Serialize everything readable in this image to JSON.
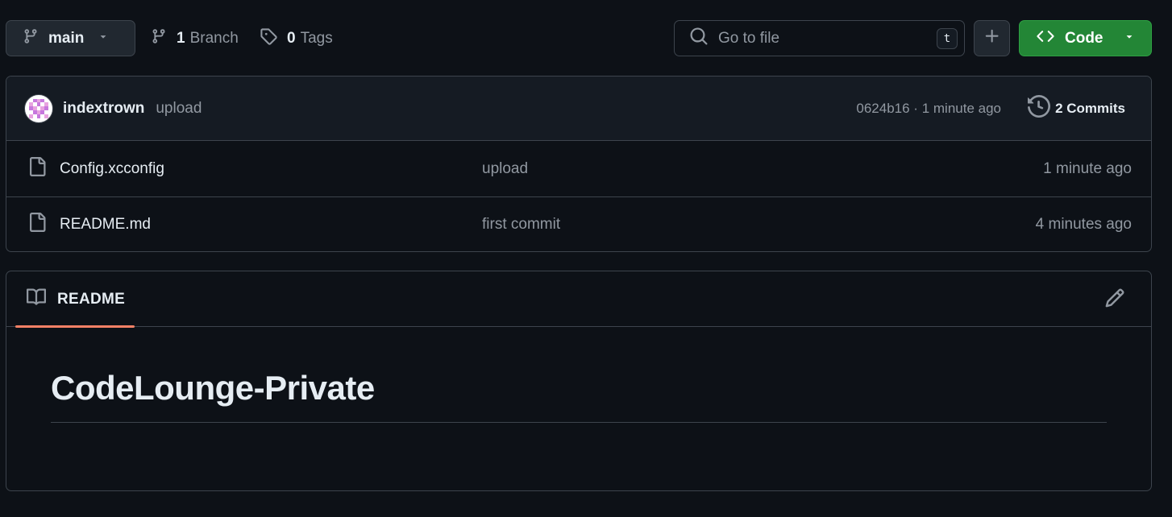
{
  "toolbar": {
    "branch_name": "main",
    "branch_count": "1",
    "branch_label": "Branch",
    "tag_count": "0",
    "tag_label": "Tags",
    "search_placeholder": "Go to file",
    "search_shortcut": "t",
    "code_label": "Code"
  },
  "latest_commit": {
    "author": "indextrown",
    "message": "upload",
    "hash": "0624b16",
    "age": "1 minute ago",
    "commits_count_label": "2 Commits"
  },
  "files": [
    {
      "name": "Config.xcconfig",
      "message": "upload",
      "age": "1 minute ago"
    },
    {
      "name": "README.md",
      "message": "first commit",
      "age": "4 minutes ago"
    }
  ],
  "readme": {
    "tab_label": "README",
    "title": "CodeLounge-Private"
  },
  "colors": {
    "background": "#0d1117",
    "border": "#3d444d",
    "primary_button": "#238636",
    "tab_underline": "#f78166",
    "muted_text": "#9198a1"
  },
  "icons": [
    "git-branch-icon",
    "chevron-down-icon",
    "tag-icon",
    "search-icon",
    "plus-icon",
    "code-icon",
    "history-icon",
    "file-icon",
    "book-icon",
    "pencil-icon"
  ]
}
